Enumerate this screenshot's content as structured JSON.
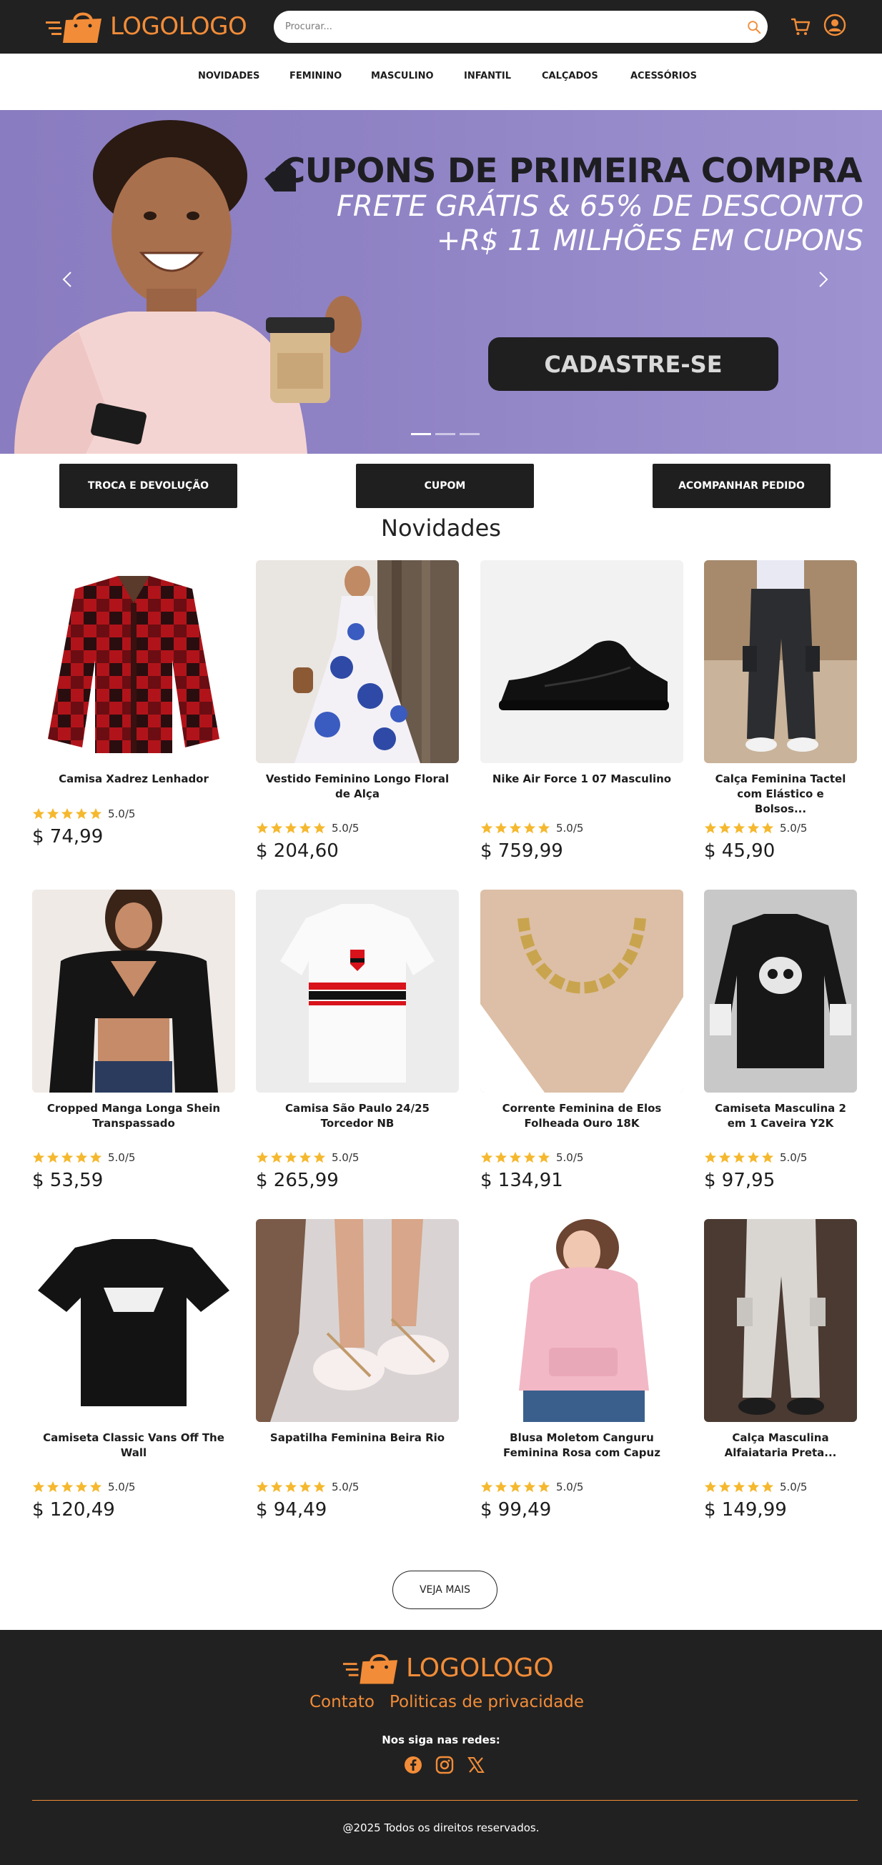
{
  "header": {
    "logo_text": "LOGOLOGO",
    "search_placeholder": "Procurar...",
    "icons": [
      "search-icon",
      "cart-icon",
      "user-icon"
    ]
  },
  "nav": {
    "items": [
      "NOVIDADES",
      "FEMININO",
      "MASCULINO",
      "INFANTIL",
      "CALÇADOS",
      "ACESSÓRIOS"
    ]
  },
  "banner": {
    "line1": "CUPONS DE PRIMEIRA COMPRA",
    "line2": "FRETE GRÁTIS & 65% DE DESCONTO",
    "line3": "+R$ 11 MILHÕES EM CUPONS",
    "cta": "CADASTRE-SE",
    "slides": 3,
    "active_slide": 1
  },
  "actions": [
    "TROCA E DEVOLUÇÃO",
    "CUPOM",
    "ACOMPANHAR PEDIDO"
  ],
  "section_title": "Novidades",
  "products": [
    {
      "name": "Camisa Xadrez Lenhador",
      "rating": "5.0/5",
      "price": "$ 74,99"
    },
    {
      "name": "Vestido Feminino Longo Floral de Alça",
      "rating": "5.0/5",
      "price": "$ 204,60"
    },
    {
      "name": "Nike Air Force 1 07 Masculino",
      "rating": "5.0/5",
      "price": "$ 759,99"
    },
    {
      "name": "Calça Feminina Tactel com Elástico e Bolsos...",
      "rating": "5.0/5",
      "price": "$ 45,90"
    },
    {
      "name": "Cropped Manga Longa Shein Transpassado",
      "rating": "5.0/5",
      "price": "$ 53,59"
    },
    {
      "name": "Camisa São Paulo 24/25 Torcedor NB",
      "rating": "5.0/5",
      "price": "$ 265,99"
    },
    {
      "name": "Corrente Feminina de Elos Folheada Ouro 18K",
      "rating": "5.0/5",
      "price": "$ 134,91"
    },
    {
      "name": "Camiseta Masculina 2 em 1 Caveira Y2K",
      "rating": "5.0/5",
      "price": "$ 97,95"
    },
    {
      "name": "Camiseta Classic Vans Off The Wall",
      "rating": "5.0/5",
      "price": "$ 120,49"
    },
    {
      "name": "Sapatilha Feminina Beira Rio",
      "rating": "5.0/5",
      "price": "$ 94,49"
    },
    {
      "name": "Blusa Moletom Canguru Feminina Rosa com Capuz",
      "rating": "5.0/5",
      "price": "$ 99,49"
    },
    {
      "name": "Calça Masculina Alfaiataria Preta...",
      "rating": "5.0/5",
      "price": "$ 149,99"
    }
  ],
  "more_button": "VEJA MAIS",
  "footer": {
    "logo_text": "LOGOLOGO",
    "links": [
      "Contato",
      "Politicas de privacidade"
    ],
    "follow": "Nos siga nas redes:",
    "socials": [
      "facebook-icon",
      "instagram-icon",
      "x-icon"
    ],
    "copyright": "@2025 Todos os direitos reservados."
  },
  "colors": {
    "header_bg": "#212121",
    "accent": "#f28c38",
    "banner_bg": "#8f82c4",
    "star": "#f5b82e",
    "button_dark": "#1f1f1f"
  }
}
